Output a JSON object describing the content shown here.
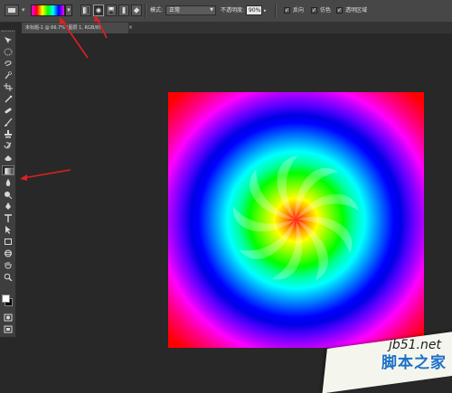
{
  "options_bar": {
    "tool_preset_icon": "gradient-tool-preset-icon",
    "gradient_swatch_colors": [
      "#ff00ff",
      "#ff0000",
      "#ffff00",
      "#00ff00",
      "#00ffff",
      "#0000ff",
      "#ff00ff"
    ],
    "gradient_types": [
      {
        "name": "linear-gradient-icon",
        "selected": false
      },
      {
        "name": "radial-gradient-icon",
        "selected": true
      },
      {
        "name": "angle-gradient-icon",
        "selected": false
      },
      {
        "name": "reflected-gradient-icon",
        "selected": false
      },
      {
        "name": "diamond-gradient-icon",
        "selected": false
      }
    ],
    "mode_label": "模式:",
    "mode_value": "正常",
    "opacity_label": "不透明度:",
    "opacity_value": "90%",
    "reverse_label": "反向",
    "dither_label": "仿色",
    "transparency_label": "透明区域",
    "reverse_checked": true,
    "dither_checked": true,
    "transparency_checked": true
  },
  "document_tab": {
    "title": "未标题-1 @ 66.7% (图层 1, RGB/8)",
    "close_symbol": "×"
  },
  "toolbox": {
    "active_tool": "gradient-tool-icon",
    "foreground_color": "#ffffff",
    "background_color": "#000000"
  },
  "watermark": {
    "domain": "jb51.net",
    "site_name": "脚本之家"
  },
  "colors": {
    "annotation_arrow": "#e02020",
    "ui_panel": "#474747",
    "workspace": "#282828"
  }
}
